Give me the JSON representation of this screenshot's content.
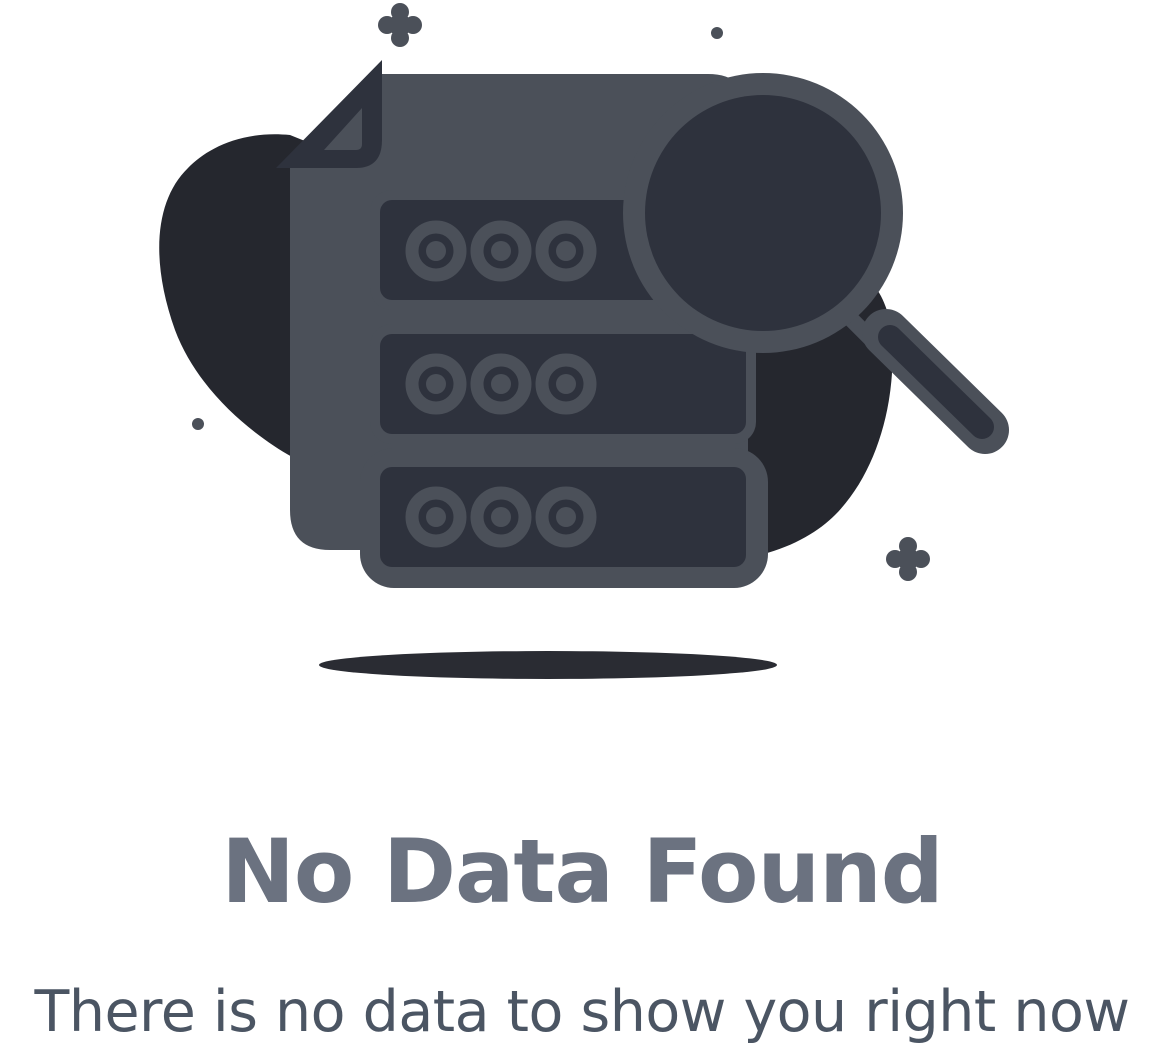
{
  "empty_state": {
    "title": "No Data Found",
    "message": "There is no data to show you right now"
  },
  "illustration": {
    "icons": [
      "document-icon",
      "server-icon",
      "magnifier-icon",
      "sparkle-icon"
    ]
  },
  "colors": {
    "title": "#6b7280",
    "message": "#4b5563",
    "blob": "#25272e",
    "document": "#4b5059",
    "slot": "#2e323d",
    "shadow": "#2a2c33"
  }
}
